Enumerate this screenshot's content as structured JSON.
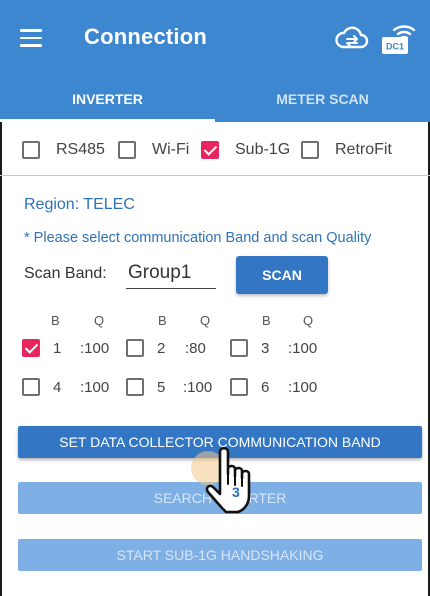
{
  "appbar": {
    "title": "Connection",
    "menu_icon": "hamburger-menu-icon",
    "cloud_icon": "cloud-sync-icon",
    "dc_icon": "dc1-wifi-icon",
    "dc_badge": "DC1"
  },
  "tabs": [
    {
      "label": "INVERTER",
      "active": true
    },
    {
      "label": "METER SCAN",
      "active": false
    }
  ],
  "comm_options": [
    {
      "label": "RS485",
      "checked": false
    },
    {
      "label": "Wi-Fi",
      "checked": false
    },
    {
      "label": "Sub-1G",
      "checked": true
    },
    {
      "label": "RetroFit",
      "checked": false
    }
  ],
  "region": {
    "text": "Region:  TELEC"
  },
  "note": "* Please select communication Band and scan Quality",
  "scan_band": {
    "label": "Scan Band:",
    "value": "Group1",
    "button": "SCAN"
  },
  "band_headers": {
    "b": "B",
    "q": "Q"
  },
  "bands": [
    {
      "num": "1",
      "q": ":100",
      "checked": true
    },
    {
      "num": "2",
      "q": ":80",
      "checked": false
    },
    {
      "num": "3",
      "q": ":100",
      "checked": false
    },
    {
      "num": "4",
      "q": ":100",
      "checked": false
    },
    {
      "num": "5",
      "q": ":100",
      "checked": false
    },
    {
      "num": "6",
      "q": ":100",
      "checked": false
    }
  ],
  "buttons": {
    "set_band": "SET DATA COLLECTOR COMMUNICATION BAND",
    "search": "SEARCH INVERTER",
    "handshake": "START SUB-1G HANDSHAKING"
  },
  "overlay": {
    "pointer_icon": "hand-pointer-icon",
    "step": "3"
  },
  "colors": {
    "primary": "#3d86d0",
    "accent": "#e8265e",
    "button": "#3377c4",
    "disabled": "#7fb0e5"
  }
}
